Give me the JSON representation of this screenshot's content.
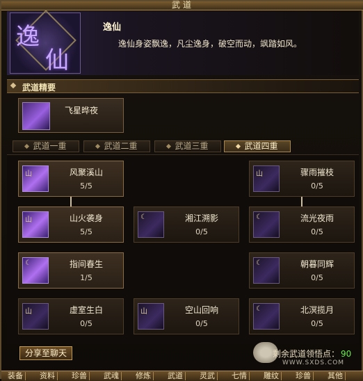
{
  "window": {
    "title": "武道"
  },
  "header": {
    "emblem_chars": [
      "逸",
      "仙"
    ],
    "name": "逸仙",
    "description": "逸仙身姿飘逸，凡尘逸身，破空而动，飒踏如风。"
  },
  "essence": {
    "section_label": "武道精要",
    "skill_name": "飞星晔夜"
  },
  "tabs": [
    {
      "label": "武道一重",
      "active": false
    },
    {
      "label": "武道二重",
      "active": false
    },
    {
      "label": "武道三重",
      "active": false
    },
    {
      "label": "武道四重",
      "active": true
    }
  ],
  "skills": {
    "r1c1": {
      "name": "风聚溪山",
      "level": "5/5",
      "lit": true
    },
    "r1c3": {
      "name": "骤雨摧枝",
      "level": "0/5",
      "lit": false
    },
    "r2c1": {
      "name": "山火袭身",
      "level": "5/5",
      "lit": true
    },
    "r2c2": {
      "name": "湘江溯影",
      "level": "0/5",
      "lit": false
    },
    "r2c3": {
      "name": "流光夜雨",
      "level": "0/5",
      "lit": false
    },
    "r3c1": {
      "name": "指间春生",
      "level": "1/5",
      "lit": true
    },
    "r3c3": {
      "name": "朝暮同辉",
      "level": "0/5",
      "lit": false
    },
    "r4c1": {
      "name": "虚室生白",
      "level": "0/5",
      "lit": false
    },
    "r4c2": {
      "name": "空山回响",
      "level": "0/5",
      "lit": false
    },
    "r4c3": {
      "name": "北溟揽月",
      "level": "0/5",
      "lit": false
    }
  },
  "footer": {
    "share_label": "分享至聊天",
    "remaining_label": "剩余武道领悟点：",
    "remaining_points": "90",
    "watermark_url": "WWW.SXDS.COM"
  },
  "bottom_bar": [
    "装备",
    "资料",
    "珍兽",
    "武魂",
    "修炼",
    "武道",
    "灵武",
    "七情",
    "雕纹",
    "珍兽",
    "其他"
  ]
}
